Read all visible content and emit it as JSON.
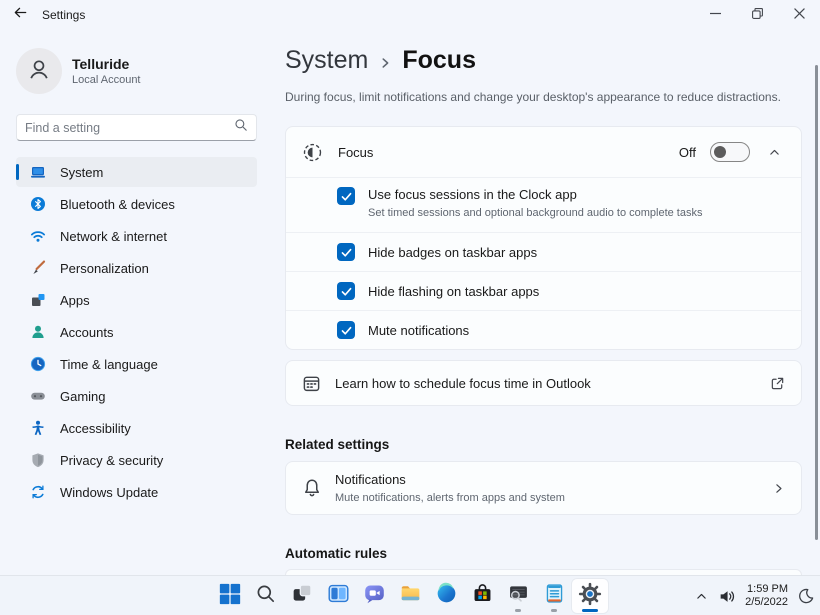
{
  "titlebar": {
    "title": "Settings"
  },
  "sidebar": {
    "account": {
      "name": "Telluride",
      "type": "Local Account"
    },
    "search": {
      "placeholder": "Find a setting"
    },
    "items": [
      {
        "label": "System",
        "selected": true
      },
      {
        "label": "Bluetooth & devices",
        "selected": false
      },
      {
        "label": "Network & internet",
        "selected": false
      },
      {
        "label": "Personalization",
        "selected": false
      },
      {
        "label": "Apps",
        "selected": false
      },
      {
        "label": "Accounts",
        "selected": false
      },
      {
        "label": "Time & language",
        "selected": false
      },
      {
        "label": "Gaming",
        "selected": false
      },
      {
        "label": "Accessibility",
        "selected": false
      },
      {
        "label": "Privacy & security",
        "selected": false
      },
      {
        "label": "Windows Update",
        "selected": false
      }
    ]
  },
  "main": {
    "breadcrumb": {
      "parent": "System",
      "current": "Focus"
    },
    "description": "During focus, limit notifications and change your desktop's appearance to reduce distractions.",
    "focus_card": {
      "title": "Focus",
      "state_label": "Off",
      "toggle_on": false,
      "options": [
        {
          "label": "Use focus sessions in the Clock app",
          "description": "Set timed sessions and optional background audio to complete tasks",
          "checked": true
        },
        {
          "label": "Hide badges on taskbar apps",
          "checked": true
        },
        {
          "label": "Hide flashing on taskbar apps",
          "checked": true
        },
        {
          "label": "Mute notifications",
          "checked": true
        }
      ]
    },
    "outlook_link": {
      "label": "Learn how to schedule focus time in Outlook"
    },
    "related": {
      "header": "Related settings",
      "items": [
        {
          "label": "Notifications",
          "description": "Mute notifications, alerts from apps and system"
        }
      ]
    },
    "automatic_rules_header": "Automatic rules"
  },
  "taskbar": {
    "icons": [
      "start",
      "search",
      "task-view",
      "widgets",
      "chat",
      "file-explorer",
      "edge",
      "store",
      "remote-screen",
      "notes",
      "settings"
    ],
    "tray": {
      "time": "1:59 PM",
      "date": "2/5/2022"
    }
  },
  "colors": {
    "accent": "#0067C0",
    "background": "#F3F6FC",
    "card": "#FBFDFE"
  }
}
